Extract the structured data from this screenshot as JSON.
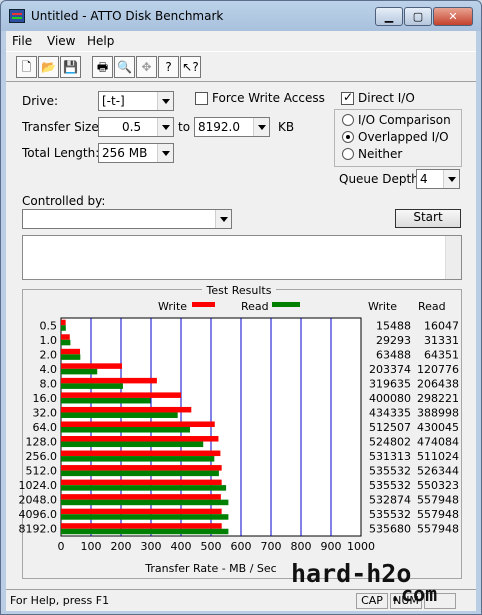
{
  "window": {
    "title": "Untitled - ATTO Disk Benchmark"
  },
  "menu": [
    "File",
    "View",
    "Help"
  ],
  "toolbar": {
    "icons": [
      "new-icon",
      "open-icon",
      "save-icon",
      "print-icon",
      "print-preview-icon",
      "move-icon",
      "help-icon",
      "context-help-icon"
    ]
  },
  "settings": {
    "drive_label": "Drive:",
    "drive_value": "[-t-]",
    "force_write_label": "Force Write Access",
    "force_write_checked": false,
    "direct_io_label": "Direct I/O",
    "direct_io_checked": true,
    "transfer_size_label": "Transfer Size:",
    "transfer_from": "0.5",
    "to_label": "to",
    "transfer_to": "8192.0",
    "kb_label": "KB",
    "total_length_label": "Total Length:",
    "total_length_value": "256 MB",
    "io_comparison_label": "I/O Comparison",
    "overlapped_io_label": "Overlapped I/O",
    "neither_label": "Neither",
    "selected_mode": "Overlapped I/O",
    "queue_depth_label": "Queue Depth:",
    "queue_depth_value": "4",
    "controlled_by_label": "Controlled by:",
    "controlled_by_value": "",
    "start_label": "Start"
  },
  "results": {
    "title": "Test Results",
    "write_legend": "Write",
    "read_legend": "Read",
    "write_col": "Write",
    "read_col": "Read",
    "write_color": "#ff0000",
    "read_color": "#008000"
  },
  "chart_data": {
    "type": "bar",
    "orientation": "horizontal",
    "title": "Test Results",
    "xlabel": "Transfer Rate - MB / Sec",
    "xlim": [
      0,
      1000
    ],
    "x_ticks": [
      "0",
      "100",
      "200",
      "300",
      "400",
      "500",
      "600",
      "700",
      "800",
      "900",
      "1000"
    ],
    "categories": [
      "0.5",
      "1.0",
      "2.0",
      "4.0",
      "8.0",
      "16.0",
      "32.0",
      "64.0",
      "128.0",
      "256.0",
      "512.0",
      "1024.0",
      "2048.0",
      "4096.0",
      "8192.0"
    ],
    "series": [
      {
        "name": "Write",
        "values": [
          15488,
          29293,
          63488,
          203374,
          319635,
          400080,
          434335,
          512507,
          524802,
          531313,
          535532,
          535532,
          532874,
          535532,
          535680
        ]
      },
      {
        "name": "Read",
        "values": [
          16047,
          31331,
          64351,
          120776,
          206438,
          298221,
          388998,
          430045,
          474084,
          511024,
          526344,
          550323,
          557948,
          557948,
          557948
        ]
      }
    ]
  },
  "status": {
    "text": "For Help, press F1",
    "cap": "CAP",
    "num": "NUM"
  },
  "watermark": {
    "main": "hard-h2o",
    "sub": ".com"
  }
}
